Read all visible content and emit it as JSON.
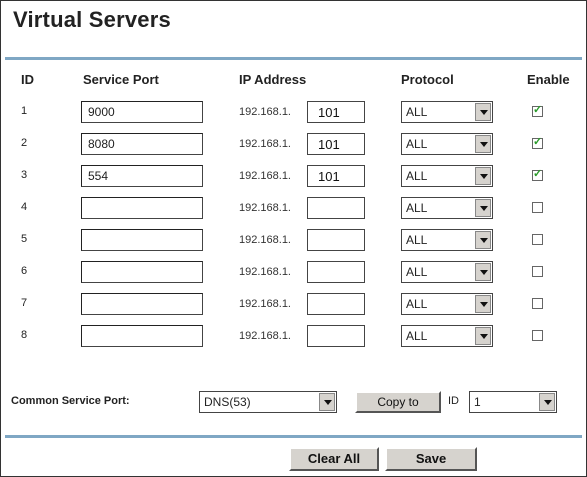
{
  "page": {
    "title": "Virtual Servers"
  },
  "headers": {
    "id": "ID",
    "service_port": "Service Port",
    "ip_address": "IP Address",
    "protocol": "Protocol",
    "enable": "Enable"
  },
  "rows": [
    {
      "id": "1",
      "port": "9000",
      "ip_prefix": "192.168.1.",
      "ip_last": "101",
      "protocol": "ALL",
      "enabled": true
    },
    {
      "id": "2",
      "port": "8080",
      "ip_prefix": "192.168.1.",
      "ip_last": "101",
      "protocol": "ALL",
      "enabled": true
    },
    {
      "id": "3",
      "port": "554",
      "ip_prefix": "192.168.1.",
      "ip_last": "101",
      "protocol": "ALL",
      "enabled": true
    },
    {
      "id": "4",
      "port": "",
      "ip_prefix": "192.168.1.",
      "ip_last": "",
      "protocol": "ALL",
      "enabled": false
    },
    {
      "id": "5",
      "port": "",
      "ip_prefix": "192.168.1.",
      "ip_last": "",
      "protocol": "ALL",
      "enabled": false
    },
    {
      "id": "6",
      "port": "",
      "ip_prefix": "192.168.1.",
      "ip_last": "",
      "protocol": "ALL",
      "enabled": false
    },
    {
      "id": "7",
      "port": "",
      "ip_prefix": "192.168.1.",
      "ip_last": "",
      "protocol": "ALL",
      "enabled": false
    },
    {
      "id": "8",
      "port": "",
      "ip_prefix": "192.168.1.",
      "ip_last": "",
      "protocol": "ALL",
      "enabled": false
    }
  ],
  "common": {
    "label": "Common Service Port:",
    "service": "DNS(53)",
    "copy_label": "Copy to",
    "id_label": "ID",
    "id_value": "1"
  },
  "footer": {
    "clear_label": "Clear All",
    "save_label": "Save"
  },
  "colors": {
    "rule": "#7fa7c4",
    "check": "#2a9a2a",
    "button_face": "#d6d3ce"
  }
}
